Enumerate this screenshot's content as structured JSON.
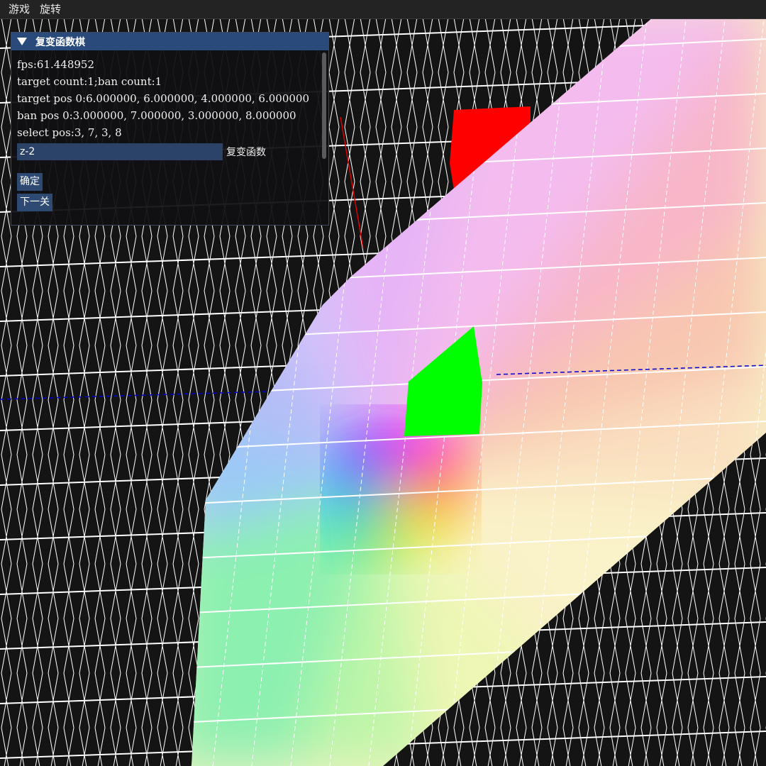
{
  "menu": [
    "游戏",
    "旋转"
  ],
  "panel": {
    "title": "复变函数棋",
    "fps": "fps:61.448952",
    "counts": "target count:1;ban count:1",
    "target_pos": "target pos 0:6.000000, 6.000000, 4.000000, 6.000000",
    "ban_pos": "ban pos 0:3.000000, 7.000000, 3.000000, 8.000000",
    "select_pos": "select pos:3, 7, 3, 8",
    "func_input_value": "z-2",
    "func_label": "复变函数",
    "confirm_label": "确定",
    "next_label": "下一关"
  },
  "scene": {
    "colors": {
      "background": "#141414",
      "grid": "#ffffff",
      "target_cell": "#00ff00",
      "ban_cell": "#ff0000",
      "axis": "#0000cc"
    }
  }
}
